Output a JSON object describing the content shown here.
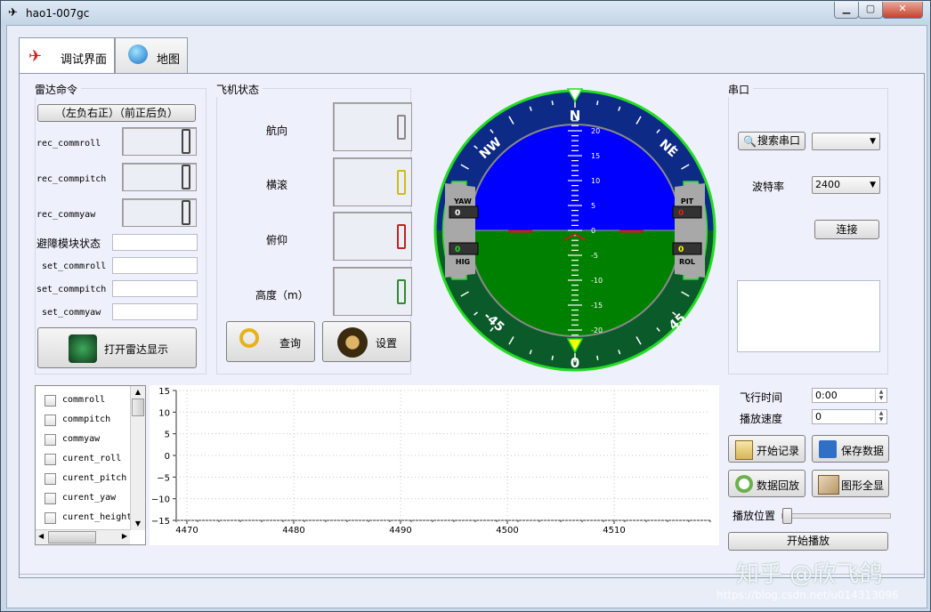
{
  "window": {
    "title": "hao1-007gc"
  },
  "tabs": [
    {
      "label": "调试界面"
    },
    {
      "label": "地图"
    }
  ],
  "radar": {
    "group_title": "雷达命令",
    "mode_button": "（左负右正）（前正后负）",
    "rec_commroll": "rec_commroll",
    "rec_commpitch": "rec_commpitch",
    "rec_commyaw": "rec_commyaw",
    "avoid_status": "避障模块状态",
    "set_commroll": "set_commroll",
    "set_commpitch": "set_commpitch",
    "set_commyaw": "set_commyaw",
    "open_radar_button": "打开雷达显示"
  },
  "aircraft": {
    "group_title": "飞机状态",
    "heading": "航向",
    "roll": "横滚",
    "pitch": "俯仰",
    "altitude": "高度（m）",
    "query_button": "查询",
    "settings_button": "设置"
  },
  "attitude": {
    "compass_labels": [
      "N",
      "NE",
      "45",
      "0",
      "-45",
      "NW"
    ],
    "pitch_ticks": [
      "20",
      "15",
      "10",
      "5",
      "0",
      "-5",
      "-10",
      "-15",
      "-20"
    ],
    "yaw_label": "YAW",
    "yaw_value": "0",
    "hig_label": "HIG",
    "hig_value": "0",
    "pit_label": "PIT",
    "pit_value": "0",
    "rol_label": "ROL",
    "rol_value": "0"
  },
  "serial": {
    "group_title": "串口",
    "search_button": "搜索串口",
    "port_value": "",
    "baud_label": "波特率",
    "baud_value": "2400",
    "connect_button": "连接"
  },
  "series_list": [
    "commroll",
    "commpitch",
    "commyaw",
    "curent_roll",
    "curent_pitch",
    "curent_yaw",
    "curent_height"
  ],
  "chart_data": {
    "type": "line",
    "series": [],
    "x_ticks": [
      "4470",
      "4480",
      "4490",
      "4500",
      "4510"
    ],
    "y_ticks": [
      "15",
      "10",
      "5",
      "0",
      "−5",
      "−10",
      "−15"
    ],
    "xlim": [
      4469,
      4519
    ],
    "ylim": [
      -15,
      15
    ],
    "grid": true
  },
  "playback": {
    "flight_time_label": "飞行时间",
    "flight_time_value": "0:00",
    "speed_label": "播放速度",
    "speed_value": "0",
    "start_record_button": "开始记录",
    "save_data_button": "保存数据",
    "replay_button": "数据回放",
    "full_graph_button": "图形全显",
    "position_label": "播放位置",
    "position": 0,
    "start_play_button": "开始播放"
  },
  "watermark": {
    "text": "知乎 @欣飞鸽",
    "url": "https://blog.csdn.net/u014313096"
  },
  "colors": {
    "sky": "#0000ff",
    "ground": "#008000",
    "bezel_top": "#0c2a86",
    "bezel_bottom": "#0b5a2a",
    "bezel_ring": "#22dd22"
  }
}
